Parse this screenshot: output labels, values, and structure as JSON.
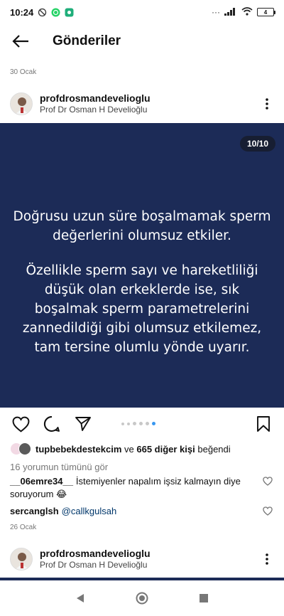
{
  "status_bar": {
    "time": "10:24",
    "battery": "4"
  },
  "header": {
    "title": "Gönderiler"
  },
  "previous_post": {
    "date": "30 Ocak"
  },
  "post": {
    "username": "profdrosmandevelioglu",
    "full_name": "Prof Dr Osman H Develioğlu",
    "page_counter": "10/10",
    "text_paragraph_1": "Doğrusu uzun süre boşalmamak sperm değerlerini olumsuz etkiler.",
    "text_paragraph_2": "Özellikle sperm sayı ve hareketliliği düşük olan erkeklerde ise, sık boşalmak sperm parametrelerini zannedildiği gibi olumsuz etkilemez, tam tersine olumlu yönde uyarır.",
    "image_bg": "#1c2b57",
    "carousel": {
      "total": 10,
      "visible_dots": 6,
      "active_dot": 6
    },
    "likes": {
      "first_liker": "tupbebekdestekcim",
      "connector": "ve",
      "others": "665 diğer kişi",
      "suffix": "beğendi"
    },
    "view_comments": "16 yorumun tümünü gör",
    "comments": [
      {
        "user": "__06emre34__",
        "text": "İstemiyenler napalım işsiz kalmayın diye soruyorum 😂"
      },
      {
        "user": "sercanglsh",
        "text": "@callkgulsah"
      }
    ],
    "date": "26 Ocak"
  },
  "next_post": {
    "username": "profdrosmandevelioglu",
    "full_name": "Prof Dr Osman H Develioğlu"
  },
  "colors": {
    "accent_dot": "#3897f0",
    "mention": "#00376b"
  }
}
